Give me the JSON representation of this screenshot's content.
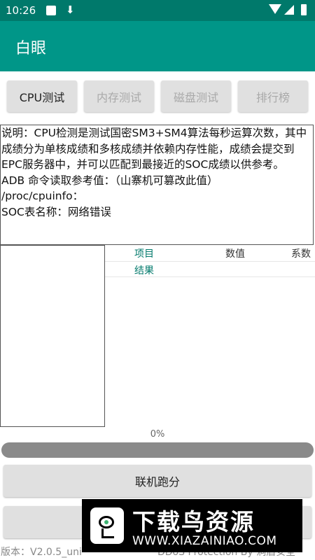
{
  "status_bar": {
    "time": "10:26"
  },
  "app_bar": {
    "title": "白眼"
  },
  "tabs": [
    {
      "label": "CPU测试",
      "state": "active"
    },
    {
      "label": "内存测试",
      "state": "disabled"
    },
    {
      "label": "磁盘测试",
      "state": "disabled"
    },
    {
      "label": "排行榜",
      "state": "disabled"
    }
  ],
  "description": {
    "line1": "说明：CPU检测是测试国密SM3+SM4算法每秒运算次数，其中成绩分为单核成绩和多核成绩并依赖内存性能，成绩会提交到EPC服务器中，并可以匹配到最接近的SOC成绩以供参考。",
    "line2": "ADB 命令读取参考值：（山寨机可篡改此值）",
    "line3": "/proc/cpuinfo：",
    "line4": "SOC表名称：网络错误"
  },
  "table": {
    "headers": {
      "item": "项目",
      "value": "数值",
      "coef": "系数"
    },
    "row_label": "结果"
  },
  "progress": {
    "label": "0%",
    "value": 0
  },
  "buttons": {
    "online_run": "联机跑分"
  },
  "footer": {
    "version": "版本：V2.0.5_uni",
    "protection": "DDoS Protection By 洞盾安全"
  },
  "banner": {
    "title": "下载鸟资源",
    "url": "WWW.XIAZAINIAO.COM"
  },
  "colors": {
    "primary": "#009688",
    "primary_dark": "#00796b",
    "button": "#e0e0e0"
  }
}
